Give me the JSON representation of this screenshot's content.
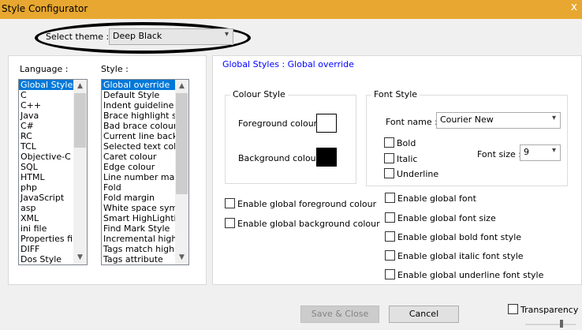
{
  "window": {
    "title": "Style Configurator",
    "close_glyph": "x"
  },
  "theme": {
    "label": "Select theme :",
    "value": "Deep Black"
  },
  "language": {
    "label": "Language :",
    "items": [
      "Global Styles",
      "C",
      "C++",
      "Java",
      "C#",
      "RC",
      "TCL",
      "Objective-C",
      "SQL",
      "HTML",
      "php",
      "JavaScript",
      "asp",
      "XML",
      "ini file",
      "Properties file",
      "DIFF",
      "Dos Style"
    ],
    "selected_index": 0
  },
  "style": {
    "label": "Style :",
    "items": [
      "Global override",
      "Default Style",
      "Indent guideline sty",
      "Brace highlight style",
      "Bad brace colour",
      "Current line backgr",
      "Selected text colour",
      "Caret colour",
      "Edge colour",
      "Line number margin",
      "Fold",
      "Fold margin",
      "White space symbo",
      "Smart HighLighting",
      "Find Mark Style",
      "Incremental highligh",
      "Tags match highligh",
      "Tags attribute"
    ],
    "selected_index": 0
  },
  "panel": {
    "heading": "Global Styles : Global override",
    "colour_style": {
      "legend": "Colour Style",
      "foreground_label": "Foreground colour",
      "foreground_color": "#ffffff",
      "background_label": "Background colour",
      "background_color": "#000000"
    },
    "font_style": {
      "legend": "Font Style",
      "font_name_label": "Font name :",
      "font_name_value": "Courier New",
      "bold_label": "Bold",
      "italic_label": "Italic",
      "underline_label": "Underline",
      "font_size_label": "Font size :",
      "font_size_value": "9"
    },
    "enable_global_fg": "Enable global foreground colour",
    "enable_global_bg": "Enable global background colour",
    "enable_global_font": "Enable global font",
    "enable_global_font_size": "Enable global font size",
    "enable_global_bold": "Enable global bold font style",
    "enable_global_italic": "Enable global italic font style",
    "enable_global_underline": "Enable global underline font style"
  },
  "buttons": {
    "save_close": "Save & Close",
    "cancel": "Cancel"
  },
  "transparency_label": "Transparency",
  "icons": {
    "dropdown": "▾",
    "scroll_up": "▲",
    "scroll_down": "▼"
  }
}
